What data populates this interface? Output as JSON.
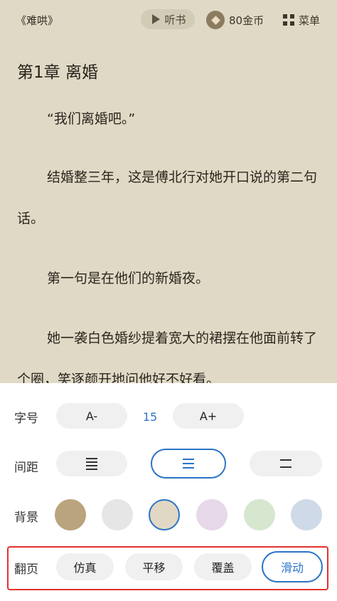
{
  "topbar": {
    "book_title": "《难哄》",
    "listen_label": "听书",
    "coins_label": "80金币",
    "menu_label": "菜单"
  },
  "content": {
    "chapter_title": "第1章 离婚",
    "paragraphs": [
      "“我们离婚吧。”",
      "结婚整三年，这是傅北行对她开口说的第二句话。",
      "第一句是在他们的新婚夜。",
      "她一袭白色婚纱提着宽大的裙摆在他面前转了个圈，笑逐颜开地问他好不好看。"
    ]
  },
  "settings": {
    "font_size": {
      "label": "字号",
      "decrease": "A-",
      "value": "15",
      "increase": "A+"
    },
    "spacing": {
      "label": "间距",
      "selected": "medium"
    },
    "background": {
      "label": "背景",
      "colors": [
        "#baa47d",
        "#e6e6e6",
        "#e0d8c4",
        "#e6d8e8",
        "#d7e6cf",
        "#cfdae8"
      ],
      "selected_index": 2
    },
    "page_turn": {
      "label": "翻页",
      "options": [
        "仿真",
        "平移",
        "覆盖",
        "滑动"
      ],
      "selected": "滑动"
    },
    "highlight_color": "#e0332f",
    "accent_color": "#2b73c8"
  }
}
